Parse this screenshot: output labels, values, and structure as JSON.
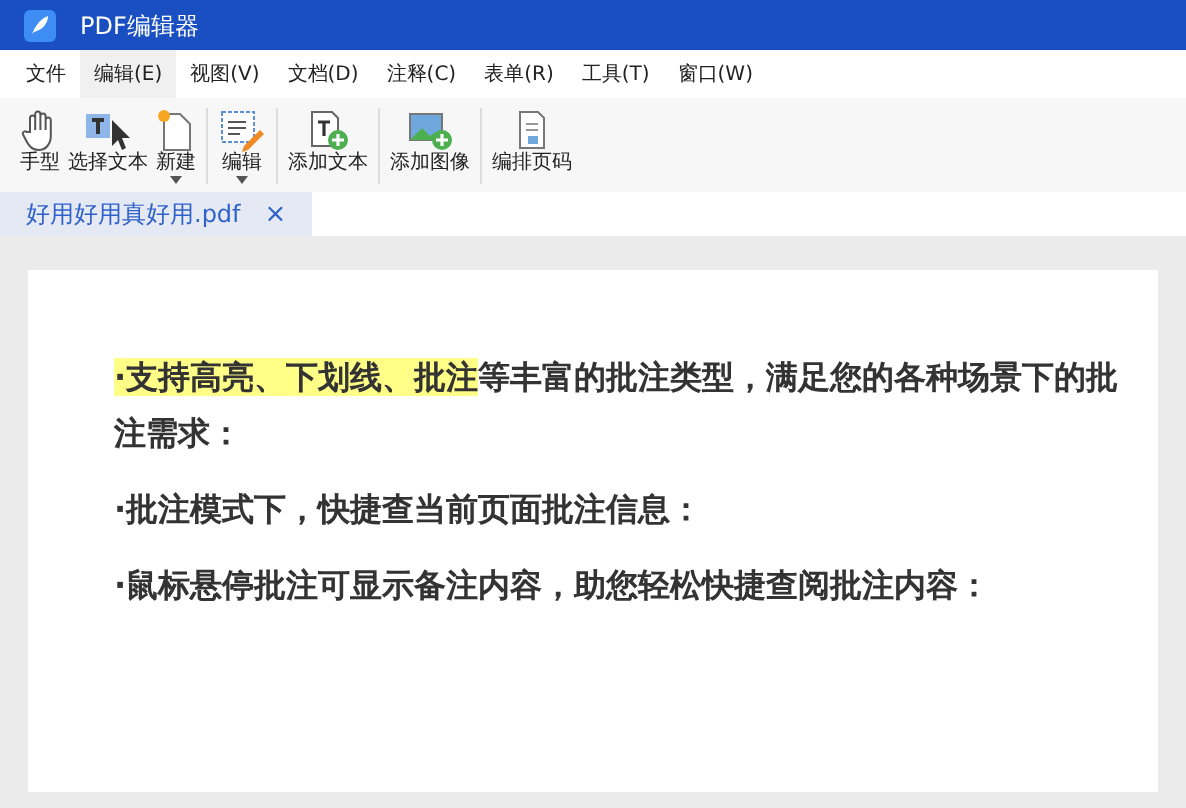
{
  "window": {
    "title": "PDF编辑器"
  },
  "menu": [
    {
      "label": "文件",
      "selected": false
    },
    {
      "label": "编辑(E)",
      "selected": true
    },
    {
      "label": "视图(V)",
      "selected": false
    },
    {
      "label": "文档(D)",
      "selected": false
    },
    {
      "label": "注释(C)",
      "selected": false
    },
    {
      "label": "表单(R)",
      "selected": false
    },
    {
      "label": "工具(T)",
      "selected": false
    },
    {
      "label": "窗口(W)",
      "selected": false
    }
  ],
  "toolbar": [
    {
      "kind": "hand",
      "label": "手型",
      "dropdown": false,
      "group_end": false
    },
    {
      "kind": "select-text",
      "label": "选择文本",
      "dropdown": false,
      "group_end": false
    },
    {
      "kind": "new",
      "label": "新建",
      "dropdown": true,
      "group_end": true
    },
    {
      "kind": "edit",
      "label": "编辑",
      "dropdown": true,
      "group_end": true
    },
    {
      "kind": "add-text",
      "label": "添加文本",
      "dropdown": false,
      "group_end": true
    },
    {
      "kind": "add-image",
      "label": "添加图像",
      "dropdown": false,
      "group_end": true
    },
    {
      "kind": "page-number",
      "label": "编排页码",
      "dropdown": false,
      "group_end": false
    }
  ],
  "tabs": [
    {
      "label": "好用好用真好用.pdf",
      "selected": true,
      "close": "×"
    }
  ],
  "document": {
    "paragraphs": [
      {
        "segments": [
          {
            "text": "·支持高亮、下划线、批注",
            "highlighted": true
          },
          {
            "text": "等丰富的批注类型，满足您的各种场景下的批注需求：",
            "highlighted": false
          }
        ]
      },
      {
        "segments": [
          {
            "text": "·批注模式下，快捷查当前页面批注信息：",
            "highlighted": false
          }
        ]
      },
      {
        "segments": [
          {
            "text": "·鼠标悬停批注可显示备注内容，助您轻松快捷查阅批注内容：",
            "highlighted": false
          }
        ]
      }
    ]
  }
}
